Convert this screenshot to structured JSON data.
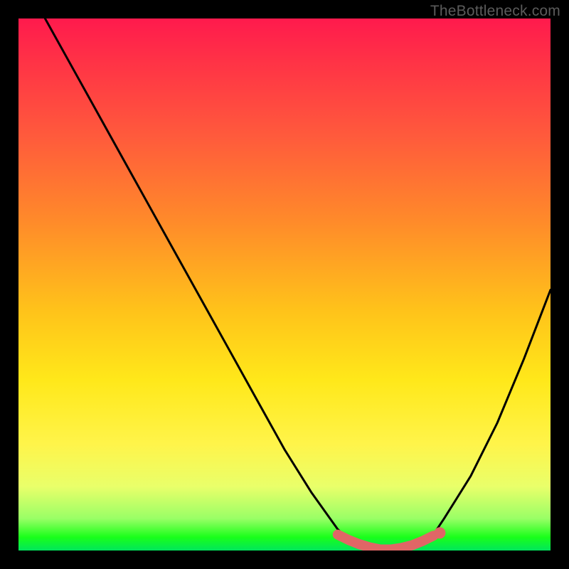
{
  "watermark": "TheBottleneck.com",
  "colors": {
    "curve_stroke": "#000000",
    "marker_fill": "#e06666",
    "marker_stroke": "#cc4e4e"
  },
  "chart_data": {
    "type": "line",
    "title": "",
    "xlabel": "",
    "ylabel": "",
    "xlim": [
      0,
      100
    ],
    "ylim": [
      0,
      100
    ],
    "series": [
      {
        "name": "bottleneck-curve",
        "x": [
          5,
          10,
          15,
          20,
          25,
          30,
          35,
          40,
          45,
          50,
          55,
          60,
          62,
          65,
          68,
          70,
          72,
          74,
          76,
          78,
          80,
          85,
          90,
          95,
          100
        ],
        "values": [
          100,
          91,
          82,
          73,
          64,
          55,
          46,
          37,
          28,
          19,
          11,
          4,
          2,
          0.5,
          0,
          0,
          0,
          0.5,
          1.5,
          3,
          6,
          14,
          24,
          36,
          49
        ]
      }
    ],
    "markers": {
      "name": "flat-bottom-markers",
      "x": [
        60,
        62,
        64,
        66,
        68,
        70,
        72,
        74,
        76,
        78
      ],
      "values": [
        3.0,
        2.0,
        1.2,
        0.6,
        0.2,
        0.2,
        0.5,
        1.0,
        1.8,
        2.8
      ]
    },
    "annotations": []
  }
}
